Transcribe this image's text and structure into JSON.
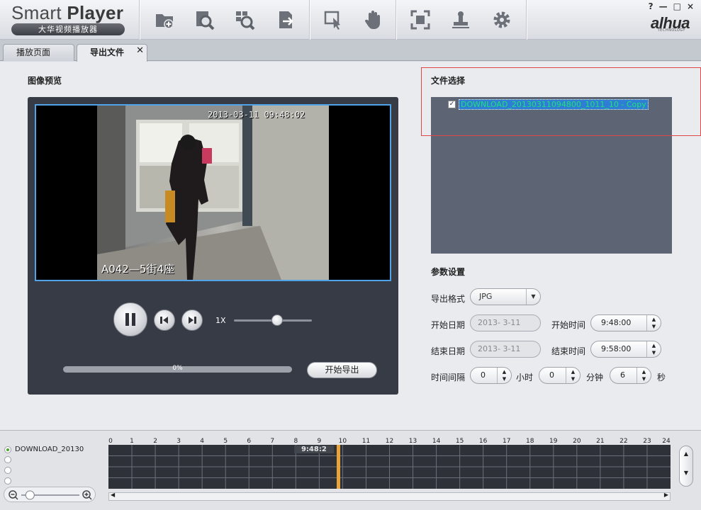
{
  "app": {
    "title_light": "Smart ",
    "title_bold": "Player",
    "subtitle": "大华视频播放器",
    "brand": "alhua",
    "brand_sub": "TECHNOLOGY",
    "window_controls": [
      "?",
      "—",
      "□",
      "×"
    ]
  },
  "toolbar": [
    {
      "name": "open-file-icon"
    },
    {
      "name": "search-record-icon"
    },
    {
      "name": "smart-search-icon"
    },
    {
      "name": "export-file-icon"
    },
    {
      "name": "select-pointer-icon"
    },
    {
      "name": "hand-drag-icon"
    },
    {
      "name": "fullscreen-icon"
    },
    {
      "name": "stamp-icon"
    },
    {
      "name": "settings-gear-icon"
    }
  ],
  "tabs": {
    "play": "播放页面",
    "export": "导出文件",
    "close": "✕"
  },
  "preview": {
    "title": "图像预览",
    "timestamp": "2013-03-11  09:48:02",
    "caption": "A042—5街4座",
    "speed": "1X",
    "speed_level": 0.55,
    "progress_text": "0%",
    "progress": 0,
    "export_button": "开始导出"
  },
  "file_select": {
    "title": "文件选择",
    "file": "DOWNLOAD_20130311094800_1011_10 - Copy",
    "checked": true
  },
  "params": {
    "title": "参数设置",
    "format_label": "导出格式",
    "format_value": "JPG",
    "start_date_label": "开始日期",
    "start_date": "2013- 3-11",
    "start_time_label": "开始时间",
    "start_time": "9:48:00",
    "end_date_label": "结束日期",
    "end_date": "2013- 3-11",
    "end_time_label": "结束时间",
    "end_time": "9:58:00",
    "interval_label": "时间间隔",
    "hours_value": "0",
    "hours_unit": "小时",
    "minutes_value": "0",
    "minutes_unit": "分钟",
    "seconds_value": "6",
    "seconds_unit": "秒"
  },
  "timeline": {
    "channels": [
      {
        "label": "DOWNLOAD_20130",
        "active": true
      },
      {
        "label": "",
        "active": false
      },
      {
        "label": "",
        "active": false
      },
      {
        "label": "",
        "active": false
      }
    ],
    "hours": [
      "0",
      "1",
      "2",
      "3",
      "4",
      "5",
      "6",
      "7",
      "8",
      "9",
      "10",
      "11",
      "12",
      "13",
      "14",
      "15",
      "16",
      "17",
      "18",
      "19",
      "20",
      "21",
      "22",
      "23",
      "24"
    ],
    "cursor_label": "9:48:2",
    "cursor_hour": 9.8,
    "zoom_level": 0.15,
    "colors": {
      "cursor": "#e8a33b",
      "grid_bg": "#2e3238"
    }
  }
}
